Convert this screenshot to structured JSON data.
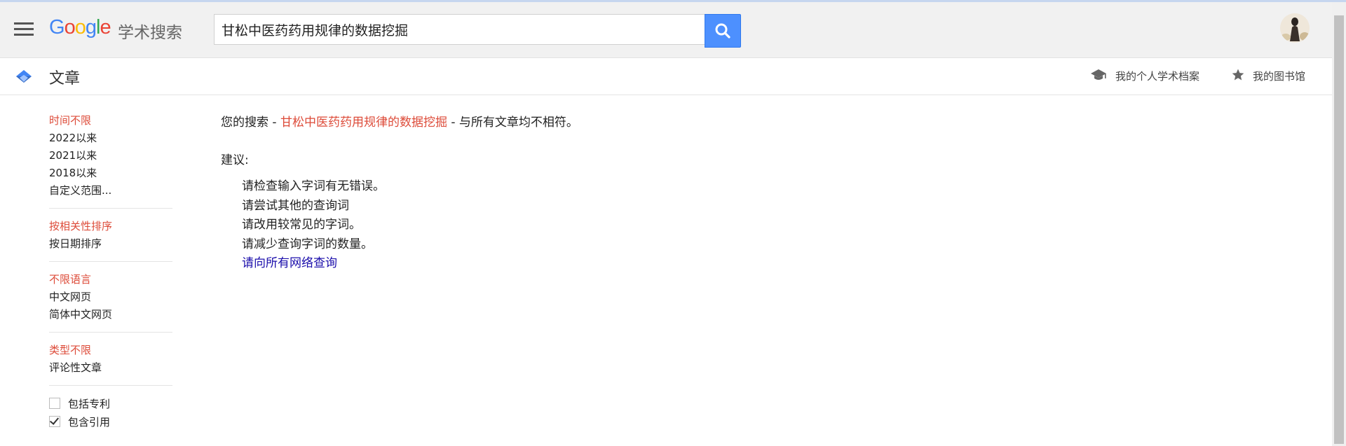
{
  "header": {
    "logo_text": "Google",
    "logo_subtitle": "学术搜索",
    "search_value": "甘松中医药药用规律的数据挖掘"
  },
  "subbar": {
    "section_title": "文章",
    "profile_link": "我的个人学术档案",
    "library_link": "我的图书馆"
  },
  "sidebar": {
    "time_filters": [
      "时间不限",
      "2022以来",
      "2021以来",
      "2018以来",
      "自定义范围..."
    ],
    "sort_options": [
      "按相关性排序",
      "按日期排序"
    ],
    "language_filters": [
      "不限语言",
      "中文网页",
      "简体中文网页"
    ],
    "type_filters": [
      "类型不限",
      "评论性文章"
    ],
    "checkboxes": [
      {
        "label": "包括专利",
        "checked": false
      },
      {
        "label": "包含引用",
        "checked": true
      }
    ]
  },
  "main": {
    "message_prefix": "您的搜索 - ",
    "message_query": "甘松中医药药用规律的数据挖掘",
    "message_suffix": " - 与所有文章均不相符。",
    "suggestions_title": "建议:",
    "suggestions": [
      "请检查输入字词有无错误。",
      "请尝试其他的查询词",
      "请改用较常见的字词。",
      "请减少查询字词的数量。"
    ],
    "web_search_link": "请向所有网络查询"
  },
  "colors": {
    "active_filter": "#dd4b39",
    "link": "#1a0dab",
    "search_button": "#4d90fe"
  }
}
